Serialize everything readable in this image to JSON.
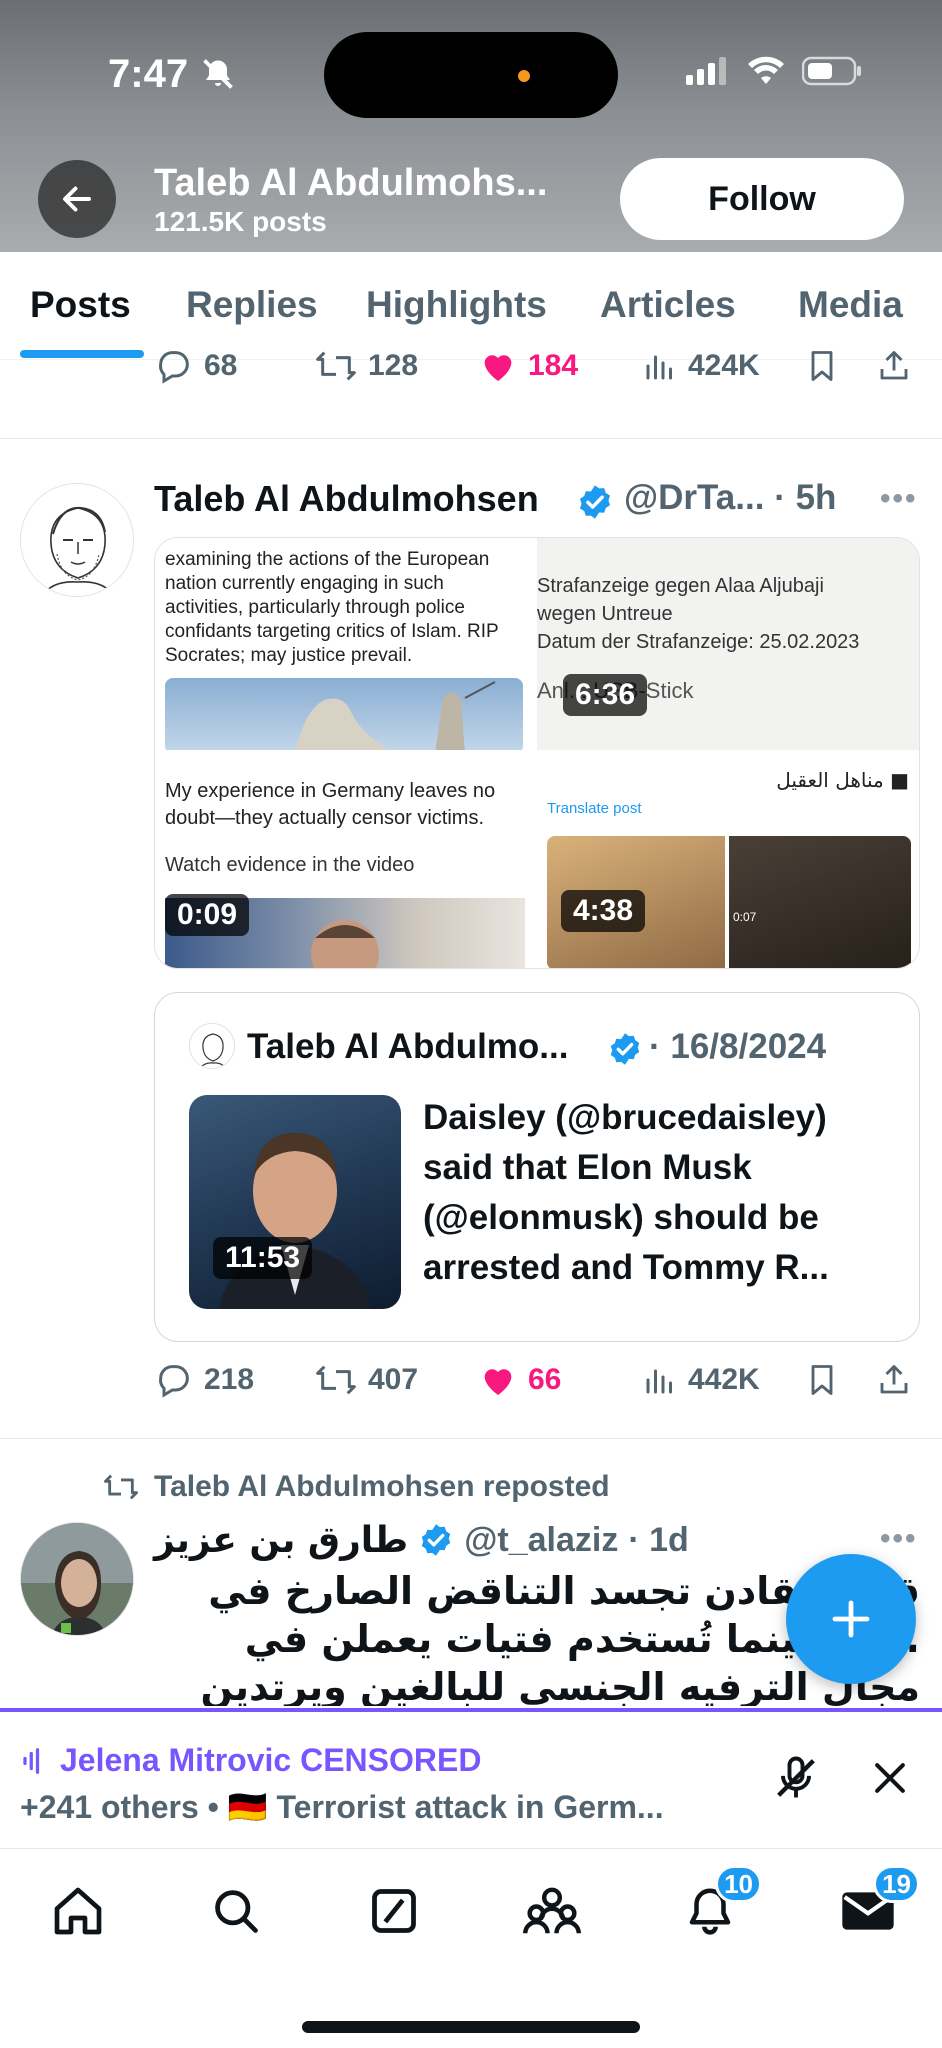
{
  "status_bar": {
    "time": "7:47"
  },
  "header": {
    "name": "Taleb Al Abdulmohs...",
    "posts_count": "121.5K posts",
    "follow_label": "Follow"
  },
  "tabs": [
    {
      "label": "Posts"
    },
    {
      "label": "Replies"
    },
    {
      "label": "Highlights"
    },
    {
      "label": "Articles"
    },
    {
      "label": "Media"
    }
  ],
  "prev_tweet_actions": {
    "replies": "68",
    "reposts": "128",
    "likes": "184",
    "views": "424K"
  },
  "tweet": {
    "name": "Taleb Al Abdulmohsen",
    "handle": "@DrTa...",
    "time": "· 5h",
    "media": [
      {
        "text": "examining the actions of the European nation currently engaging in such activities, particularly through police confidants targeting critics of Islam. RIP Socrates; may justice prevail."
      },
      {
        "text_lines": [
          "Strafanzeige gegen Alaa Aljubaji",
          "wegen Untreue",
          "Datum der Strafanzeige: 25.02.2023"
        ],
        "overlay": "Anl... USB-Stick",
        "duration": "6:36"
      },
      {
        "text": "My experience in Germany leaves no doubt—they actually censor victims.",
        "text2": "Watch evidence in the video",
        "duration": "0:09"
      },
      {
        "header_ar": "■ مناهل العقيل",
        "translate": "Translate post",
        "duration": "4:38",
        "small": "0:07"
      }
    ],
    "quote": {
      "name": "Taleb Al Abdulmo...",
      "date": "· 16/8/2024",
      "duration": "11:53",
      "text": "Daisley (@brucedaisley) said that Elon Musk (@elonmusk) should be arrested and Tommy R..."
    },
    "actions": {
      "replies": "218",
      "reposts": "407",
      "likes": "66",
      "views": "442K"
    }
  },
  "repost": {
    "label": "Taleb Al Abdulmohsen reposted",
    "name": "طارق بن عزيز",
    "handle": "@t_alaziz",
    "time": "· 1d",
    "lines": [
      "قصة مقادن تجسد التناقض الصارخ في",
      "...ية؛ بينما تُستخدم فتيات يعملن في",
      "مجال الترفيه الجنسي للبالغين ويرتدين فنايل"
    ]
  },
  "spaces": {
    "title": "Jelena Mitrovic CENSORED",
    "subtitle": "+241 others • 🇩🇪 Terrorist attack in Germ..."
  },
  "nav": {
    "notifications_badge": "10",
    "messages_badge": "19"
  },
  "colors": {
    "accent": "#1d9bf0",
    "like": "#f91880",
    "spaces": "#7856ff"
  }
}
